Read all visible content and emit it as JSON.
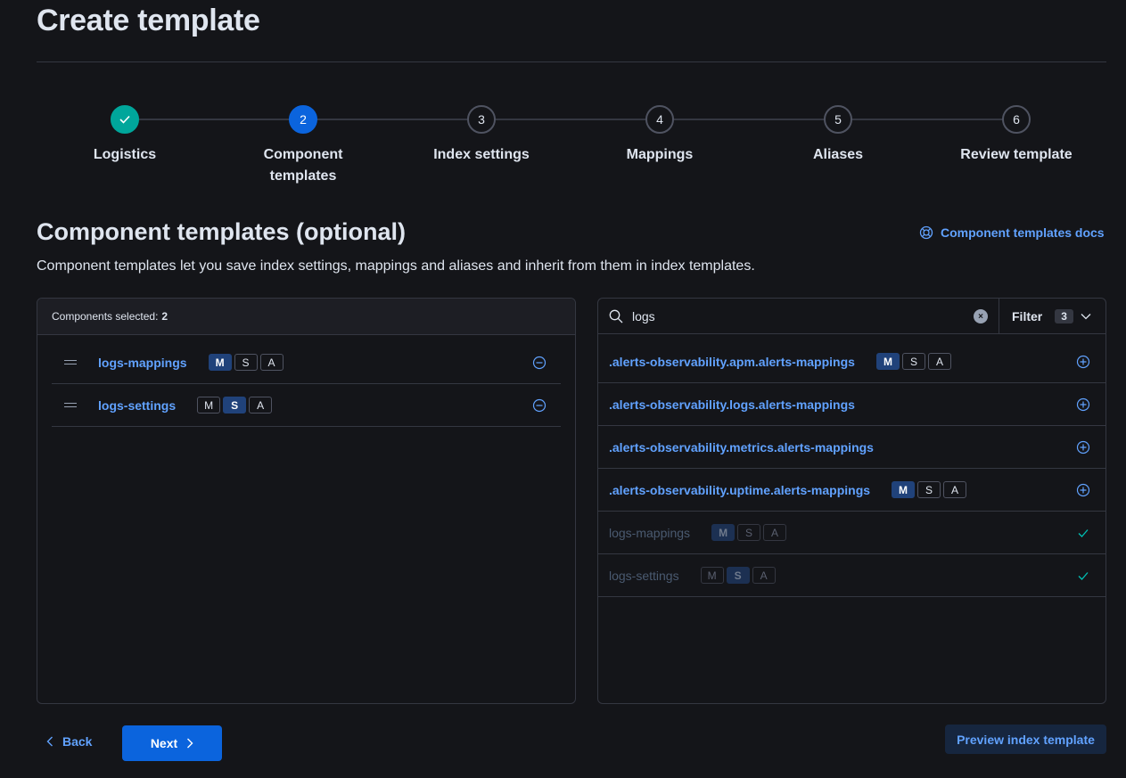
{
  "page": {
    "title": "Create template"
  },
  "steps": [
    {
      "number": "1",
      "label": "Logistics",
      "status": "complete"
    },
    {
      "number": "2",
      "label": "Component\ntemplates",
      "status": "current"
    },
    {
      "number": "3",
      "label": "Index settings",
      "status": "incomplete"
    },
    {
      "number": "4",
      "label": "Mappings",
      "status": "incomplete"
    },
    {
      "number": "5",
      "label": "Aliases",
      "status": "incomplete"
    },
    {
      "number": "6",
      "label": "Review template",
      "status": "incomplete"
    }
  ],
  "section": {
    "title": "Component templates (optional)",
    "description": "Component templates let you save index settings, mappings and aliases and inherit from them in index templates.",
    "docs_link": "Component templates docs"
  },
  "selected_panel": {
    "header_label": "Components selected:",
    "count": "2",
    "items": [
      {
        "name": "logs-mappings",
        "badges": {
          "M": true,
          "S": false,
          "A": false
        }
      },
      {
        "name": "logs-settings",
        "badges": {
          "M": false,
          "S": true,
          "A": false
        }
      }
    ]
  },
  "search_panel": {
    "query": "logs",
    "filter_label": "Filter",
    "filter_count": "3",
    "results": [
      {
        "name": ".alerts-observability.apm.alerts-mappings",
        "badges": {
          "M": true,
          "S": false,
          "A": false
        },
        "show_badges": true,
        "selected": false
      },
      {
        "name": ".alerts-observability.logs.alerts-mappings",
        "show_badges": false,
        "selected": false
      },
      {
        "name": ".alerts-observability.metrics.alerts-mappings",
        "show_badges": false,
        "selected": false
      },
      {
        "name": ".alerts-observability.uptime.alerts-mappings",
        "badges": {
          "M": true,
          "S": false,
          "A": false
        },
        "show_badges": true,
        "selected": false
      },
      {
        "name": "logs-mappings",
        "badges": {
          "M": true,
          "S": false,
          "A": false
        },
        "show_badges": true,
        "selected": true
      },
      {
        "name": "logs-settings",
        "badges": {
          "M": false,
          "S": true,
          "A": false
        },
        "show_badges": true,
        "selected": true
      }
    ]
  },
  "badge_letters": [
    "M",
    "S",
    "A"
  ],
  "footer": {
    "back_label": "Back",
    "next_label": "Next",
    "preview_label": "Preview index template"
  },
  "colors": {
    "background": "#141519",
    "accent": "#0b64dd",
    "link": "#61a2ff",
    "success": "#00a69b"
  }
}
